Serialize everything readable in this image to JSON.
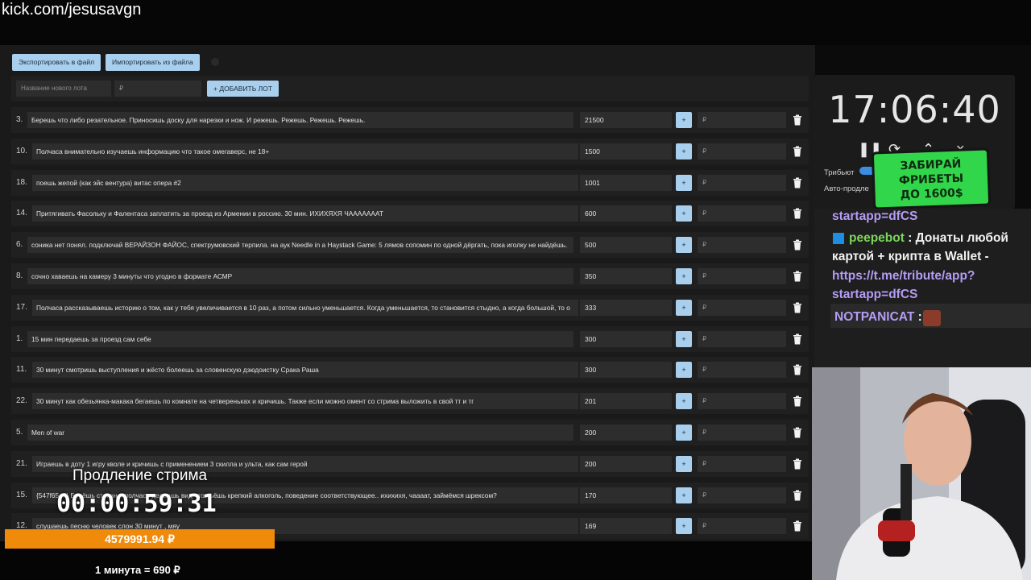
{
  "browser": {
    "url": "kick.com/jesusavgn"
  },
  "toolbar": {
    "export_label": "Экспортировать в файл",
    "import_label": "Импортировать из файла"
  },
  "add_lot": {
    "name_placeholder": "Название нового лота",
    "amount_placeholder": "₽",
    "add_label": "+ ДОБАВИТЬ ЛОТ"
  },
  "lots": [
    {
      "num": "3.",
      "text": "Берешь что либо резательное. Приносишь доску для нарезки и нож. И режешь. Режешь. Режешь. Режешь.",
      "amount": "21500"
    },
    {
      "num": "10.",
      "text": "Полчаса внимательно изучаешь информацию что такое омегаверс, не 18+",
      "amount": "1500"
    },
    {
      "num": "18.",
      "text": "поешь жепой (как эйс вентура) витас опера #2",
      "amount": "1001"
    },
    {
      "num": "14.",
      "text": "Притягивать Фасольку и Фалентаса заплатить за проезд из Армении в россию. 30 мин. ИХИХЯХЯ ЧАААААААТ",
      "amount": "600"
    },
    {
      "num": "6.",
      "text": "соника нет понял. подключай ВЕРАЙЗОН ФАЙОС, спектрумовский терпила. на аук Needle in a Haystack Game: 5 лямов сопомин по одной дёргать, пока иголку не найдёшь.",
      "amount": "500"
    },
    {
      "num": "8.",
      "text": "сочно хаваешь на камеру 3 минуты что угодно в формате АСМР",
      "amount": "350"
    },
    {
      "num": "17.",
      "text": "Полчаса рассказываешь историю о том, как у тебя увеличивается в 10 раз, а потом сильно уменьшается. Когда уменьшается, то становится стыдно, а когда большой, то о",
      "amount": "333"
    },
    {
      "num": "1.",
      "text": "15 мин передаешь за проезд сам себе",
      "amount": "300"
    },
    {
      "num": "11.",
      "text": "30 минут смотришь выступления и жёсто болеешь за словенскую дзюдоистку Срака Раша",
      "amount": "300"
    },
    {
      "num": "22.",
      "text": "30 минут как обезьянка-макака бегаешь по комнате на четвереньках и кричишь. Также если можно омент со стрима выложить в свой тт и тг",
      "amount": "201"
    },
    {
      "num": "5.",
      "text": "Men of war",
      "amount": "200"
    },
    {
      "num": "21.",
      "text": "Играешь в доту 1 игру кволе и кричишь с применением 3 скилла и ульта, как сам герой",
      "amount": "200"
    },
    {
      "num": "15.",
      "text": "{547f65d7} Берёшь стакан и полчаса делаешь вид что пьёшь крепкий алкоголь, поведение соответствующее.. ихихихя, чааaат, займёмся шрексом?",
      "amount": "170"
    },
    {
      "num": "12.",
      "text": "слушаешь песню человек слон 30 минут , мяу",
      "amount": "169"
    }
  ],
  "lot_plus_label": "+",
  "lot_rub_placeholder": "₽",
  "timer_panel": {
    "time": "17:06:40",
    "tribute_label": "Трибьют",
    "auto_label": "Авто-продле"
  },
  "promo": {
    "line1": "ЗАБИРАЙ",
    "line2": "ФРИБЕТЫ",
    "line3": "ДО 1600$"
  },
  "chat": {
    "line0": "startapp=dfCS",
    "nick1": "peepebot",
    "msg1a": " : Донаты любой",
    "msg1b": "картой + крипта в Wallet -",
    "link1": "https://t.me/tribute/app?",
    "link2": "startapp=dfCS",
    "nick2": "NOTPANICAT",
    "msg2": " :"
  },
  "overlay": {
    "extension_label": "Продление стрима",
    "extension_timer": "00:00:59:31",
    "total": "4579991.94 ₽",
    "rate": "1 минута = 690 ₽"
  },
  "colors": {
    "accent_button": "#a9cfee",
    "progress_bar": "#f08a0a",
    "promo_green": "#32d64a",
    "chat_link": "#b59cf5",
    "nick_green": "#7bd65a"
  }
}
